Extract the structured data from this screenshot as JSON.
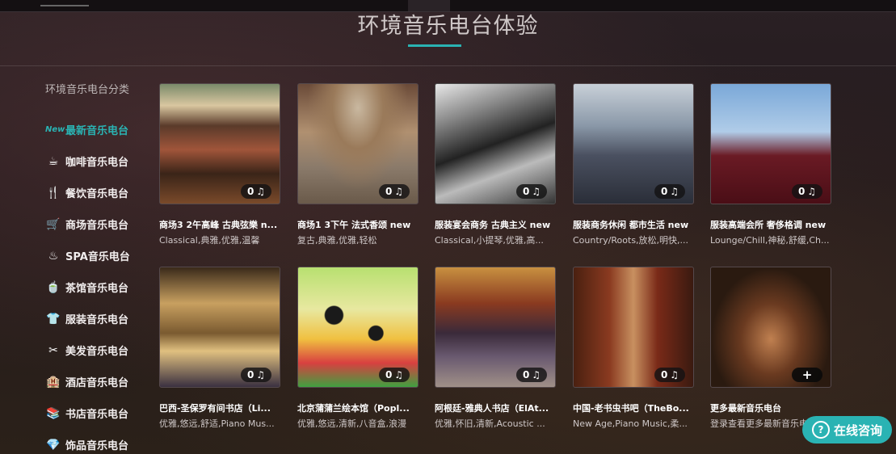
{
  "page": {
    "heading": "环境音乐电台体验",
    "accent_color": "#2ab3b3"
  },
  "sidebar": {
    "title": "环境音乐电台分类",
    "items": [
      {
        "label": "最新音乐电台",
        "icon": "new-badge-icon",
        "icon_text": "New",
        "active": true
      },
      {
        "label": "咖啡音乐电台",
        "icon": "coffee-cup-icon",
        "icon_text": "☕"
      },
      {
        "label": "餐饮音乐电台",
        "icon": "fork-knife-icon",
        "icon_text": "🍴"
      },
      {
        "label": "商场音乐电台",
        "icon": "shopping-cart-icon",
        "icon_text": "🛒"
      },
      {
        "label": "SPA音乐电台",
        "icon": "spa-massage-icon",
        "icon_text": "♨"
      },
      {
        "label": "茶馆音乐电台",
        "icon": "teapot-icon",
        "icon_text": "🍵"
      },
      {
        "label": "服装音乐电台",
        "icon": "tshirt-icon",
        "icon_text": "👕"
      },
      {
        "label": "美发音乐电台",
        "icon": "hairdryer-icon",
        "icon_text": "✂"
      },
      {
        "label": "酒店音乐电台",
        "icon": "hotel-building-icon",
        "icon_text": "🏨"
      },
      {
        "label": "书店音乐电台",
        "icon": "books-icon",
        "icon_text": "📚"
      },
      {
        "label": "饰品音乐电台",
        "icon": "diamond-icon",
        "icon_text": "💎"
      }
    ]
  },
  "cards": [
    {
      "title": "商场3 2午高峰 古典弦樂 n...",
      "tags": "Classical,典雅,优雅,温馨",
      "count": "0",
      "scene": "shopping-mall-atrium"
    },
    {
      "title": "商场1 3下午 法式香颂 new",
      "tags": "复古,典雅,优雅,轻松",
      "count": "0",
      "scene": "arched-shopping-arcade"
    },
    {
      "title": "服装宴会商务 古典主义 new",
      "tags": "Classical,小提琴,优雅,高...",
      "count": "0",
      "scene": "black-white-banquet"
    },
    {
      "title": "服装商务休闲 都市生活 new",
      "tags": "Country/Roots,放松,明快,...",
      "count": "0",
      "scene": "man-in-suit-street"
    },
    {
      "title": "服装高端会所 奢侈格调 new",
      "tags": "Lounge/Chill,神秘,舒缓,Ch...",
      "count": "0",
      "scene": "man-in-velvet-jacket"
    },
    {
      "title": "巴西-圣保罗有间书店（Li...",
      "tags": "优雅,悠远,舒适,Piano Mus...",
      "count": "0",
      "scene": "bookstore-sao-paulo"
    },
    {
      "title": "北京蒲蒲兰绘本馆（Popl...",
      "tags": "优雅,悠远,清新,八音盒,浪漫",
      "count": "0",
      "scene": "colorful-kids-bookstore"
    },
    {
      "title": "阿根廷-雅典人书店（ElAt...",
      "tags": "优雅,怀旧,清新,Acoustic ...",
      "count": "0",
      "scene": "theatre-bookstore"
    },
    {
      "title": "中国-老书虫书吧（TheBo...",
      "tags": "New Age,Piano Music,柔...",
      "count": "0",
      "scene": "book-bar-shelves"
    },
    {
      "title": "更多最新音乐电台",
      "tags": "登录查看更多最新音乐电台",
      "more": true,
      "scene": "cafe-lounge"
    }
  ],
  "playlist_icon": "♫",
  "more_icon": "+",
  "chat": {
    "label": "在线咨询",
    "icon": "?"
  }
}
